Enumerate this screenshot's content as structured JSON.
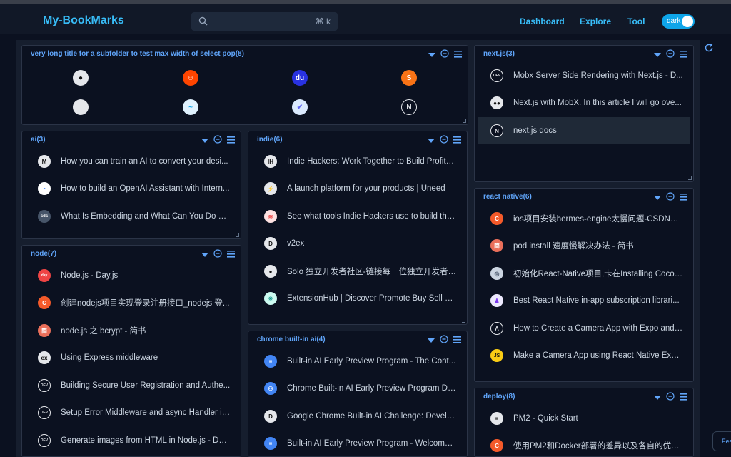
{
  "app": {
    "title": "My-BookMarks"
  },
  "search": {
    "shortcut": "⌘ k"
  },
  "nav": {
    "dashboard": "Dashboard",
    "explore": "Explore",
    "tool": "Tool"
  },
  "theme": {
    "label": "dark"
  },
  "feedback": {
    "label": "Fee"
  },
  "colors": {
    "accent": "#38bdf8",
    "panel_title": "#60a5fa",
    "background": "#0b1120"
  },
  "panels": {
    "subfolder": {
      "title": "very long title for a subfolder to test max width of select pop(8)",
      "icons": [
        "github-icon",
        "reddit-icon",
        "baidu-icon",
        "stackedit-icon",
        "apple-icon",
        "tailwind-icon",
        "vite-icon",
        "nextjs-icon"
      ]
    },
    "ai": {
      "title": "ai(3)",
      "items": [
        {
          "label": "How you can train an AI to convert your desi...",
          "icon": "medium-icon"
        },
        {
          "label": "How to build an OpenAI Assistant with Intern...",
          "icon": "google-icon"
        },
        {
          "label": "What Is Embedding and What Can You Do wi...",
          "icon": "sds-icon"
        }
      ]
    },
    "node": {
      "title": "node(7)",
      "items": [
        {
          "label": "Node.js · Day.js",
          "icon": "dayjs-icon"
        },
        {
          "label": "创建nodejs项目实现登录注册接口_nodejs 登...",
          "icon": "csdn-icon"
        },
        {
          "label": "node.js 之 bcrypt - 简书",
          "icon": "jianshu-icon"
        },
        {
          "label": "Using Express middleware",
          "icon": "express-icon"
        },
        {
          "label": "Building Secure User Registration and Authe...",
          "icon": "dev-icon"
        },
        {
          "label": "Setup Error Middleware and async Handler in...",
          "icon": "dev-icon"
        },
        {
          "label": "Generate images from HTML in Node.js - DE...",
          "icon": "dev-icon"
        }
      ]
    },
    "indie": {
      "title": "indie(6)",
      "items": [
        {
          "label": "Indie Hackers: Work Together to Build Profita...",
          "icon": "indiehackers-icon"
        },
        {
          "label": "A launch platform for your products | Uneed",
          "icon": "bolt-icon"
        },
        {
          "label": "See what tools Indie Hackers use to build the...",
          "icon": "stack-icon"
        },
        {
          "label": "v2ex",
          "icon": "v2ex-icon"
        },
        {
          "label": "Solo 独立开发者社区-链接每一位独立开发者, ...",
          "icon": "solo-icon"
        },
        {
          "label": "ExtensionHub | Discover Promote Buy Sell Br...",
          "icon": "extensionhub-icon"
        }
      ]
    },
    "chrome": {
      "title": "chrome built-in ai(4)",
      "items": [
        {
          "label": "Built-in AI Early Preview Program - The Cont...",
          "icon": "doc-icon"
        },
        {
          "label": "Chrome Built-in AI Early Preview Program Dis...",
          "icon": "group-icon"
        },
        {
          "label": "Google Chrome Built-in AI Challenge: Develo...",
          "icon": "devpost-icon"
        },
        {
          "label": "Built-in AI Early Preview Program - Welcome ...",
          "icon": "doc-icon"
        }
      ]
    },
    "nextjs": {
      "title": "next.js(3)",
      "items": [
        {
          "label": "Mobx Server Side Rendering with Next.js - D...",
          "icon": "dev-icon"
        },
        {
          "label": "Next.js with MobX. In this article I will go ove...",
          "icon": "medium-dots-icon"
        },
        {
          "label": "next.js docs",
          "icon": "nextjs-icon"
        }
      ]
    },
    "reactnative": {
      "title": "react native(6)",
      "items": [
        {
          "label": "ios项目安装hermes-engine太慢问题-CSDN博...",
          "icon": "csdn-icon"
        },
        {
          "label": "pod install 速度慢解决办法 - 简书",
          "icon": "jianshu-icon"
        },
        {
          "label": "初始化React-Native项目,卡在Installing Cocoa...",
          "icon": "globe-icon"
        },
        {
          "label": "Best React Native in-app subscription librari...",
          "icon": "revenuecat-icon"
        },
        {
          "label": "How to Create a Camera App with Expo and ...",
          "icon": "expo-icon"
        },
        {
          "label": "Make a Camera App using React Native Expo...",
          "icon": "js-icon"
        }
      ]
    },
    "deploy": {
      "title": "deploy(8)",
      "items": [
        {
          "label": "PM2 - Quick Start",
          "icon": "pm2-icon"
        },
        {
          "label": "使用PM2和Docker部署的差异以及各自的优点...",
          "icon": "csdn-icon"
        }
      ]
    }
  }
}
